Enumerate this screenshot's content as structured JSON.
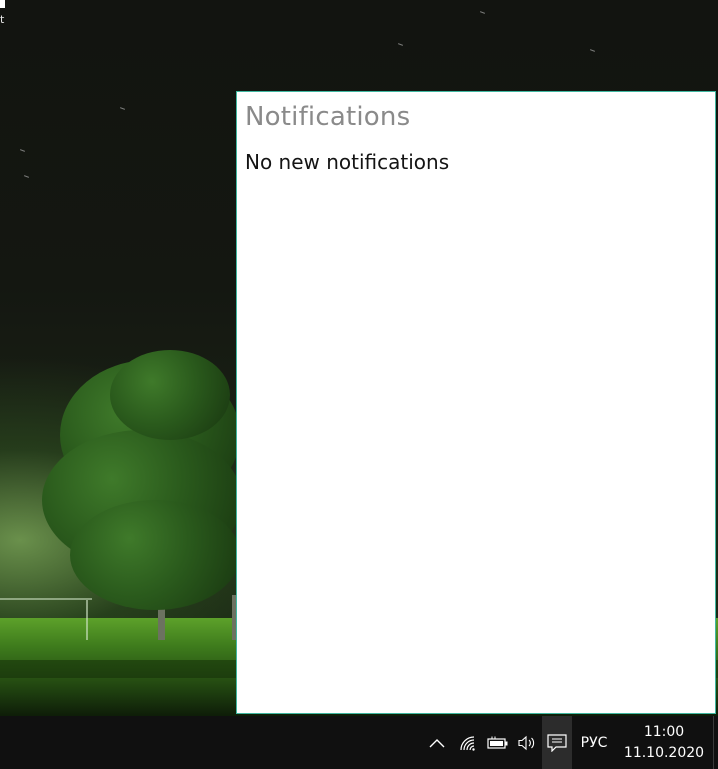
{
  "desktop": {
    "corner_text": "t"
  },
  "notifications": {
    "title": "Notifications",
    "empty_message": "No new notifications"
  },
  "taskbar": {
    "tray": {
      "icons": [
        "chevron-up-icon",
        "wifi-icon",
        "battery-charging-icon",
        "volume-icon",
        "action-center-icon"
      ],
      "language": "РУС",
      "time": "11:00",
      "date": "11.10.2020"
    }
  },
  "colors": {
    "panel_border": "#3fb7a0",
    "taskbar": "#101010",
    "title_text": "#8a8a8a"
  }
}
